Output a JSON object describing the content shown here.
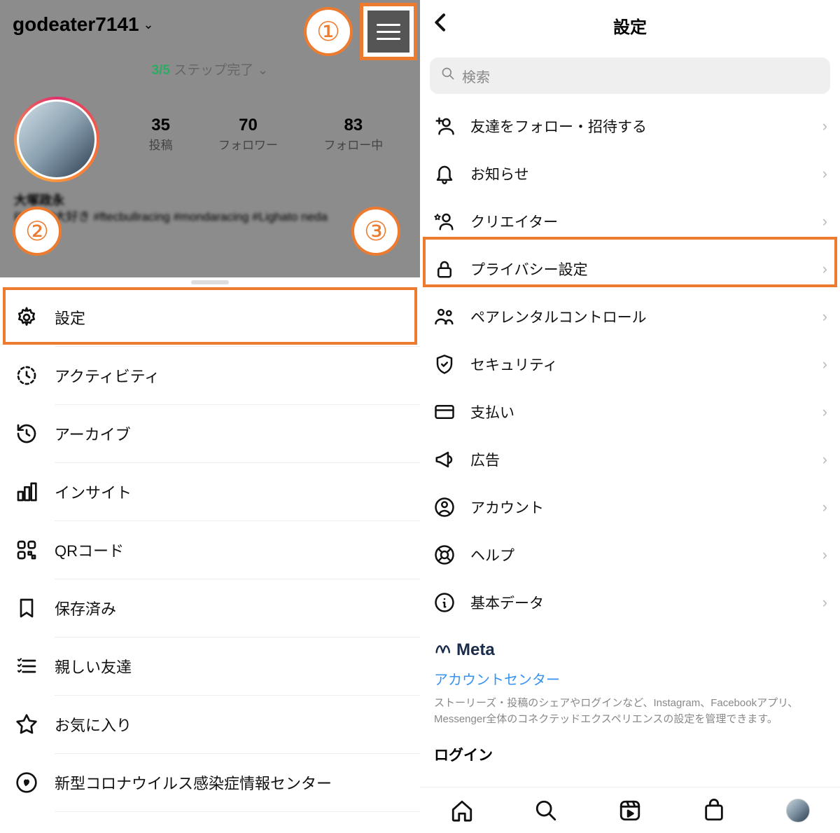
{
  "left": {
    "username": "godeater7141",
    "step_fraction": "3/5",
    "step_text": "ステップ完了",
    "stats": [
      {
        "num": "35",
        "label": "投稿"
      },
      {
        "num": "70",
        "label": "フォロワー"
      },
      {
        "num": "83",
        "label": "フォロー中"
      }
    ],
    "bio_name": "大塚政永",
    "bio_text": "Redbull大好き #ftecbullracing #mondaracing #Lighato\n                 neda",
    "menu": [
      {
        "label": "設定"
      },
      {
        "label": "アクティビティ"
      },
      {
        "label": "アーカイブ"
      },
      {
        "label": "インサイト"
      },
      {
        "label": "QRコード"
      },
      {
        "label": "保存済み"
      },
      {
        "label": "親しい友達"
      },
      {
        "label": "お気に入り"
      },
      {
        "label": "新型コロナウイルス感染症情報センター"
      }
    ],
    "badges": {
      "one": "①",
      "two": "②",
      "three": "③"
    }
  },
  "right": {
    "title": "設定",
    "search_placeholder": "検索",
    "items": [
      {
        "label": "友達をフォロー・招待する"
      },
      {
        "label": "お知らせ"
      },
      {
        "label": "クリエイター"
      },
      {
        "label": "プライバシー設定"
      },
      {
        "label": "ペアレンタルコントロール"
      },
      {
        "label": "セキュリティ"
      },
      {
        "label": "支払い"
      },
      {
        "label": "広告"
      },
      {
        "label": "アカウント"
      },
      {
        "label": "ヘルプ"
      },
      {
        "label": "基本データ"
      }
    ],
    "meta": {
      "brand": "Meta",
      "link": "アカウントセンター",
      "desc": "ストーリーズ・投稿のシェアやログインなど、Instagram、Facebookアプリ、Messenger全体のコネクテッドエクスペリエンスの設定を管理できます。"
    },
    "login_header": "ログイン"
  }
}
